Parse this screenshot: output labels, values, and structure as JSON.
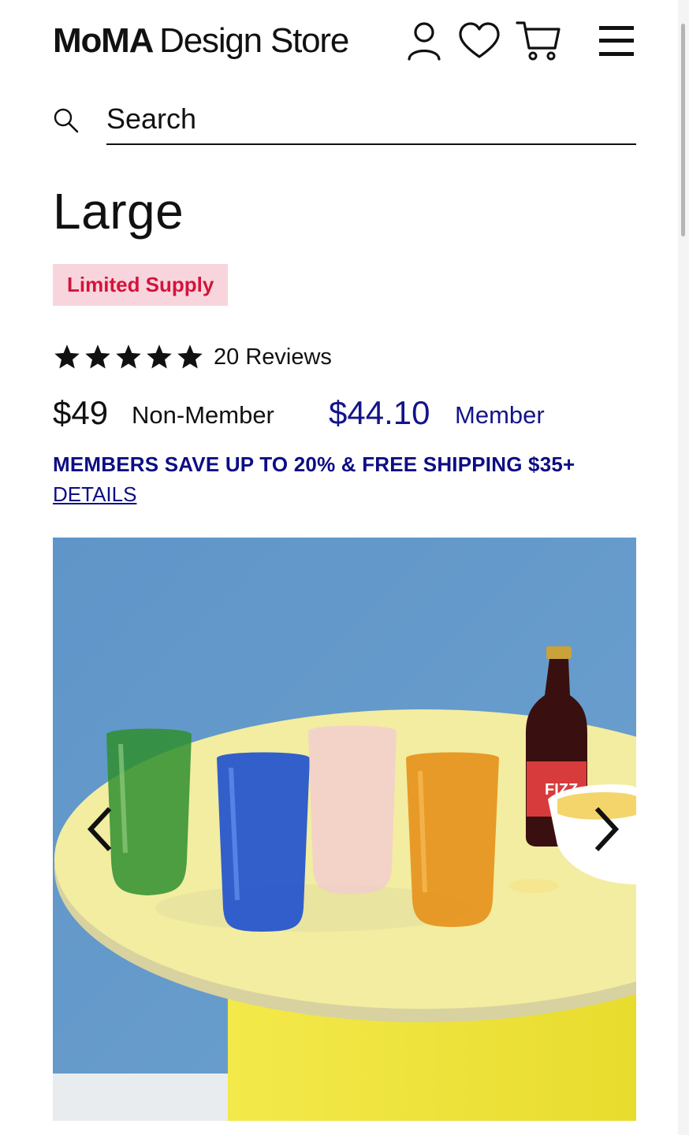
{
  "header": {
    "brand_bold": "MoMA",
    "brand_light": "Design Store",
    "icons": [
      "account-icon",
      "heart-icon",
      "cart-icon",
      "menu-icon"
    ]
  },
  "search": {
    "placeholder": "Search",
    "value": ""
  },
  "product": {
    "title": "Large",
    "badge": "Limited Supply",
    "rating": 5,
    "rating_max": 5,
    "reviews_label": "20 Reviews",
    "price_non_member": "$49",
    "label_non_member": "Non-Member",
    "price_member": "$44.10",
    "label_member": "Member"
  },
  "promo": {
    "text": "MEMBERS SAVE UP TO 20% & FREE SHIPPING $35+",
    "link": "DETAILS"
  },
  "gallery": {
    "prev_icon": "chevron-left-icon",
    "next_icon": "chevron-right-icon",
    "bottle_label_text": "FIZZ"
  },
  "colors": {
    "member_blue": "#14148a",
    "badge_bg": "#f8d5dc",
    "badge_text": "#d3143c",
    "photo_wall": "#5a92c6",
    "tabletop": "#f2eda0",
    "table_base": "#f0e63a"
  }
}
